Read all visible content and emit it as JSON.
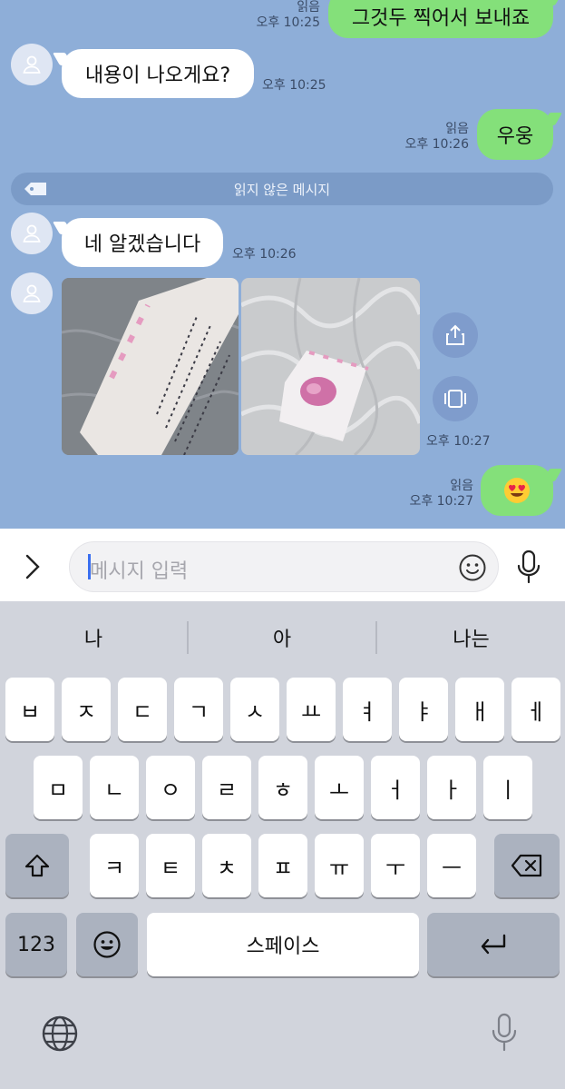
{
  "colors": {
    "chat_bg": "#8eaed8",
    "outgoing": "#84e07a",
    "incoming": "#ffffff",
    "keyboard_bg": "#d1d4dc"
  },
  "messages": {
    "m1": {
      "text": "그것두 찍어서 보내죠",
      "read": "읽음",
      "time": "오후 10:25"
    },
    "m2": {
      "text": "내용이 나오게요?",
      "time": "오후 10:25"
    },
    "m3": {
      "text": "우웅",
      "read": "읽음",
      "time": "오후 10:26"
    },
    "unread_divider": "읽지 않은 메시지",
    "m4": {
      "text": "네 알겠습니다",
      "time": "오후 10:26"
    },
    "m5": {
      "time": "오후 10:27"
    },
    "m6": {
      "text": "😍",
      "read": "읽음",
      "time": "오후 10:27"
    }
  },
  "input": {
    "placeholder": "메시지 입력"
  },
  "keyboard": {
    "suggestions": [
      "나",
      "아",
      "나는"
    ],
    "row1": [
      "ㅂ",
      "ㅈ",
      "ㄷ",
      "ㄱ",
      "ㅅ",
      "ㅛ",
      "ㅕ",
      "ㅑ",
      "ㅐ",
      "ㅔ"
    ],
    "row2": [
      "ㅁ",
      "ㄴ",
      "ㅇ",
      "ㄹ",
      "ㅎ",
      "ㅗ",
      "ㅓ",
      "ㅏ",
      "ㅣ"
    ],
    "row3": [
      "ㅋ",
      "ㅌ",
      "ㅊ",
      "ㅍ",
      "ㅠ",
      "ㅜ",
      "ㅡ"
    ],
    "numbers_label": "123",
    "space_label": "스페이스"
  },
  "icons": [
    "person-icon",
    "share-icon",
    "gallery-icon",
    "chevron-right-icon",
    "emoji-icon",
    "mic-icon",
    "shift-icon",
    "backspace-icon",
    "return-icon",
    "globe-icon",
    "dictation-icon",
    "unread-tag-icon"
  ]
}
